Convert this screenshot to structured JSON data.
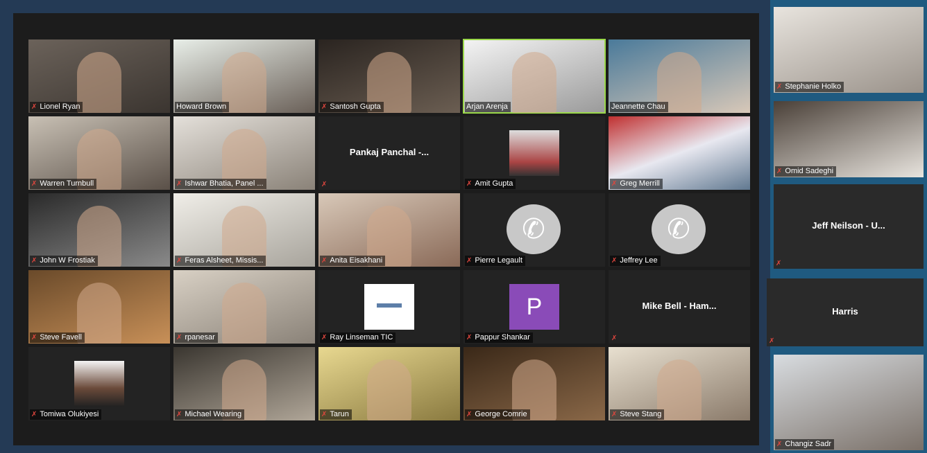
{
  "meeting": {
    "gallery": [
      {
        "name": "Lionel Ryan",
        "kind": "video",
        "muted": true
      },
      {
        "name": "Howard Brown",
        "kind": "video",
        "muted": false
      },
      {
        "name": "Santosh Gupta",
        "kind": "video",
        "muted": true
      },
      {
        "name": "Arjan Arenja",
        "kind": "video",
        "muted": false,
        "active_speaker": true
      },
      {
        "name": "Jeannette Chau",
        "kind": "video",
        "muted": false
      },
      {
        "name": "Warren Turnbull",
        "kind": "video",
        "muted": true
      },
      {
        "name": "Ishwar Bhatia, Panel ...",
        "kind": "video",
        "muted": true
      },
      {
        "name": "Pankaj Panchal -...",
        "kind": "name-only",
        "muted": true
      },
      {
        "name": "Amit Gupta",
        "kind": "profile-photo",
        "muted": true
      },
      {
        "name": "Greg Merrill",
        "kind": "video",
        "muted": true
      },
      {
        "name": "John W Frostiak",
        "kind": "video",
        "muted": true
      },
      {
        "name": "Feras Alsheet, Missis...",
        "kind": "video",
        "muted": true
      },
      {
        "name": "Anita Eisakhani",
        "kind": "video",
        "muted": true
      },
      {
        "name": "Pierre Legault",
        "kind": "phone",
        "muted": true
      },
      {
        "name": "Jeffrey Lee",
        "kind": "phone",
        "muted": true
      },
      {
        "name": "Steve Favell",
        "kind": "video",
        "muted": true
      },
      {
        "name": "rpanesar",
        "kind": "video",
        "muted": true
      },
      {
        "name": "Ray Linseman TIC",
        "kind": "logo",
        "muted": true
      },
      {
        "name": "Pappur Shankar",
        "kind": "initial",
        "initial": "P",
        "muted": true
      },
      {
        "name": "Mike Bell - Ham...",
        "kind": "name-only",
        "muted": true
      },
      {
        "name": "Tomiwa Olukiyesi",
        "kind": "profile-photo",
        "muted": true
      },
      {
        "name": "Michael Wearing",
        "kind": "video",
        "muted": true
      },
      {
        "name": "Tarun",
        "kind": "video",
        "muted": true
      },
      {
        "name": "George Comrie",
        "kind": "video",
        "muted": true
      },
      {
        "name": "Steve Stang",
        "kind": "video",
        "muted": true
      }
    ],
    "side_panel": [
      {
        "name": "Stephanie Holko",
        "kind": "video",
        "muted": true
      },
      {
        "name": "Omid Sadeghi",
        "kind": "video",
        "muted": true
      },
      {
        "name": "Jeff Neilson - U...",
        "kind": "name-only",
        "muted": true
      },
      {
        "name": "Harris",
        "kind": "name-only",
        "muted": true
      },
      {
        "name": "Changiz Sadr",
        "kind": "video",
        "muted": true
      }
    ]
  }
}
